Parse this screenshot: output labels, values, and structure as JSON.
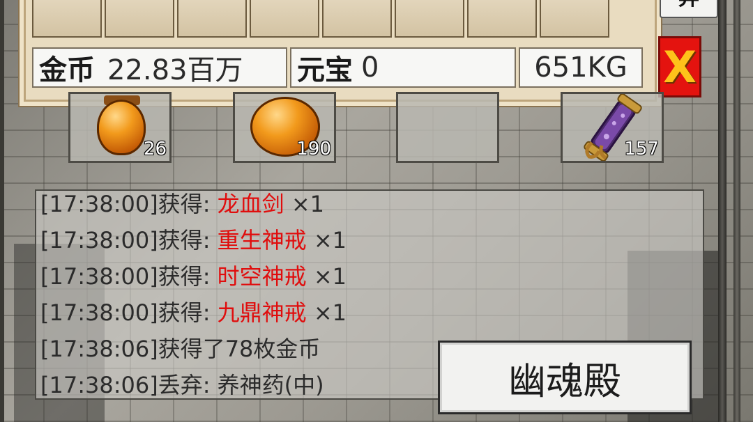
{
  "inventory": {
    "top_button_label": "弃",
    "close_label": "X",
    "gold": {
      "label": "金币",
      "value": "22.83百万"
    },
    "yuanbao": {
      "label": "元宝",
      "value": "0"
    },
    "weight": {
      "value": "651KG"
    }
  },
  "quick_slots": [
    {
      "icon": "orange-potion-small-icon",
      "count": "26"
    },
    {
      "icon": "orange-potion-large-icon",
      "count": "190"
    },
    {
      "icon": "",
      "count": ""
    },
    {
      "icon": "purple-scroll-icon",
      "count": "157"
    }
  ],
  "chat_log": [
    {
      "prefix": "[17:38:00]获得: ",
      "item": "龙血剑",
      "suffix": " ×1"
    },
    {
      "prefix": "[17:38:00]获得: ",
      "item": "重生神戒",
      "suffix": " ×1"
    },
    {
      "prefix": "[17:38:00]获得: ",
      "item": "时空神戒",
      "suffix": " ×1"
    },
    {
      "prefix": "[17:38:00]获得: ",
      "item": "九鼎神戒",
      "suffix": " ×1"
    },
    {
      "prefix": "[17:38:06]获得了78枚金币",
      "item": "",
      "suffix": ""
    },
    {
      "prefix": "[17:38:06]丢弃: 养神药(中)",
      "item": "",
      "suffix": ""
    }
  ],
  "location": {
    "name": "幽魂殿"
  },
  "colors": {
    "item_highlight": "#e00d0d",
    "close_button": "#e4130f",
    "close_text": "#ffc21a"
  }
}
